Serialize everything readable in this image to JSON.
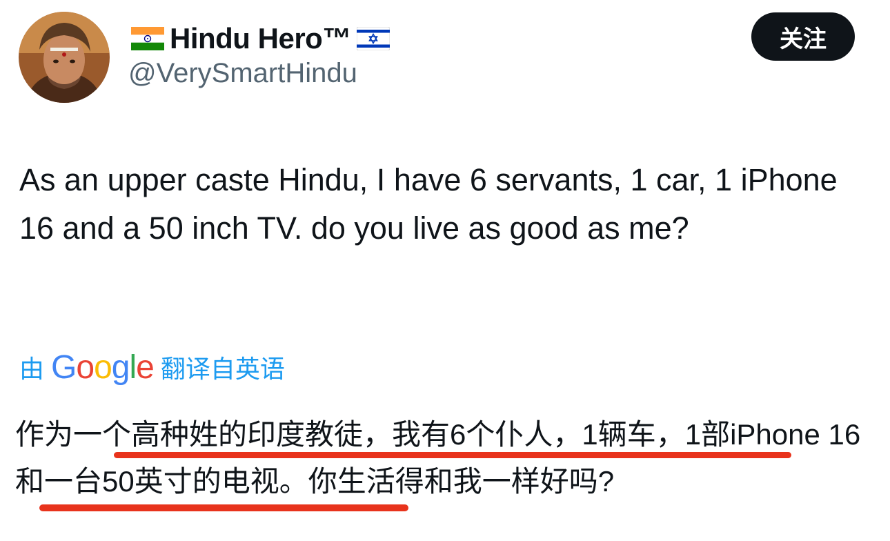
{
  "user": {
    "display_name": "Hindu Hero™",
    "handle": "@VerySmartHindu",
    "flag_left": "india-flag-icon",
    "flag_right": "israel-flag-icon"
  },
  "follow_button": {
    "label": "关注"
  },
  "tweet": {
    "text": "As an upper caste Hindu, I have 6 servants, 1 car, 1 iPhone 16 and a 50 inch TV. do you live as good as me?"
  },
  "translation": {
    "prefix": "由",
    "provider": "Google",
    "suffix": "翻译自英语",
    "text": "作为一个高种姓的印度教徒，我有6个仆人，1辆车，1部iPhone 16和一台50英寸的电视。你生活得和我一样好吗?"
  },
  "colors": {
    "link_blue": "#1d9bf0",
    "underline_red": "#e8331c",
    "button_bg": "#0f1419"
  }
}
